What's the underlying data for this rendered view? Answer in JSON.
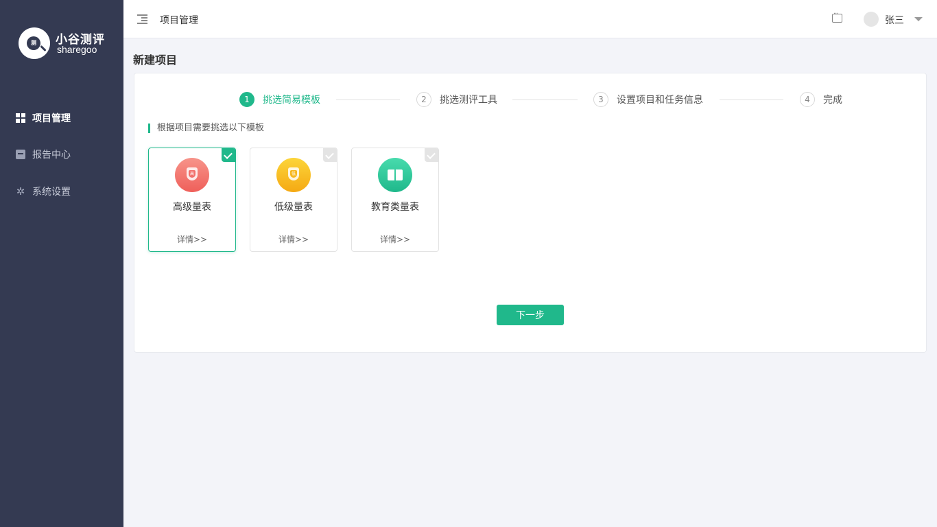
{
  "brand": {
    "logo_mark": "测",
    "name_cn": "小谷测评",
    "name_en": "sharegoo"
  },
  "sidebar": {
    "items": [
      {
        "label": "项目管理",
        "icon": "grid-icon",
        "active": true
      },
      {
        "label": "报告中心",
        "icon": "inbox-icon",
        "active": false
      },
      {
        "label": "系统设置",
        "icon": "gear-icon",
        "active": false
      }
    ]
  },
  "header": {
    "title": "项目管理",
    "user_name": "张三"
  },
  "page": {
    "title": "新建项目"
  },
  "steps": [
    {
      "num": "1",
      "label": "挑选简易模板",
      "active": true
    },
    {
      "num": "2",
      "label": "挑选测评工具",
      "active": false
    },
    {
      "num": "3",
      "label": "设置项目和任务信息",
      "active": false
    },
    {
      "num": "4",
      "label": "完成",
      "active": false
    }
  ],
  "section_label": "根据项目需要挑选以下模板",
  "templates": [
    {
      "name": "高级量表",
      "detail": "详情>>",
      "selected": true,
      "icon": "shield-icon",
      "icon_char": "高",
      "color": "#f2706b"
    },
    {
      "name": "低级量表",
      "detail": "详情>>",
      "selected": false,
      "icon": "shield-icon",
      "icon_char": "低",
      "color": "#f7b81f"
    },
    {
      "name": "教育类量表",
      "detail": "详情>>",
      "selected": false,
      "icon": "book-icon",
      "icon_char": "",
      "color": "#2cc99a"
    }
  ],
  "next_button": "下一步",
  "colors": {
    "sidebar_bg": "#343a52",
    "accent": "#20b88b",
    "page_bg": "#f3f4f9"
  }
}
